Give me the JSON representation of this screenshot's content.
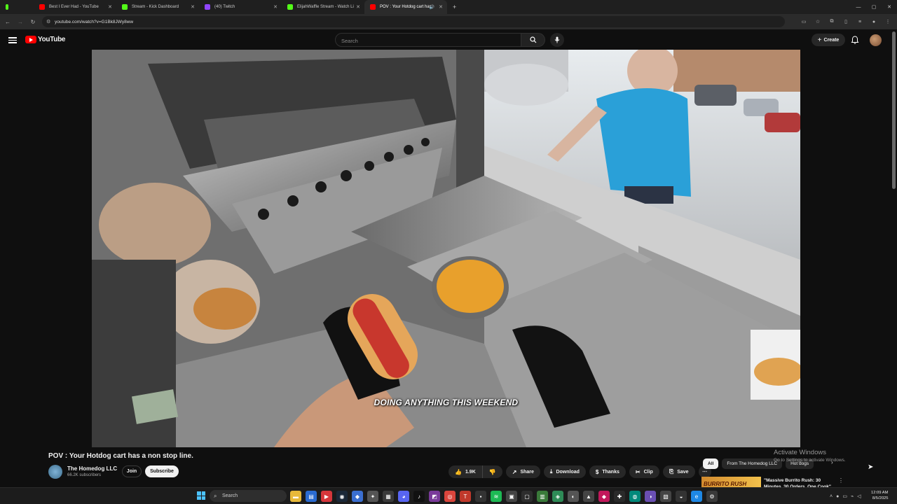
{
  "browser": {
    "tabs": [
      {
        "label": "",
        "fav_color": "#53fc18"
      },
      {
        "label": "",
        "fav_color": "#9146ff"
      },
      {
        "label": "Best I Ever Had - YouTube",
        "fav_color": "#ff0000"
      },
      {
        "label": "Stream - Kick Dashboard",
        "fav_color": "#53fc18"
      },
      {
        "label": "(40) Twitch",
        "fav_color": "#9146ff"
      },
      {
        "label": "ElijahWaffle Stream - Watch Li",
        "fav_color": "#53fc18"
      },
      {
        "label": "POV : Your Hotdog cart has",
        "fav_color": "#ff0000",
        "active": true
      }
    ],
    "new_tab_label": "+",
    "url": "youtube.com/watch?v=G1Bk8JWy8ww"
  },
  "youtube": {
    "logo_text": "YouTube",
    "search_placeholder": "Search",
    "create_label": "Create"
  },
  "video": {
    "caption": "DOING ANYTHING THIS WEEKEND",
    "title": "POV : Your Hotdog cart has a non stop line.",
    "channel_name": "The Homedog LLC",
    "subscribers": "66.2K subscribers",
    "join_label": "Join",
    "subscribe_label": "Subscribe",
    "likes": "1.9K",
    "actions": {
      "share": "Share",
      "download": "Download",
      "thanks": "Thanks",
      "clip": "Clip",
      "save": "Save"
    }
  },
  "chips": [
    "All",
    "From The Homedog LLC",
    "Hot dogs"
  ],
  "recommendation": {
    "thumb_text": "BURRITO RUSH",
    "title": "\"Massive Burrito Rush: 30 Minutes, 30 Orders, One Cook\""
  },
  "watermark": {
    "line1": "Activate Windows",
    "line2": "Go to Settings to activate Windows."
  },
  "taskbar": {
    "search_label": "Search",
    "time": "12:09 AM",
    "date": "8/5/2025"
  }
}
